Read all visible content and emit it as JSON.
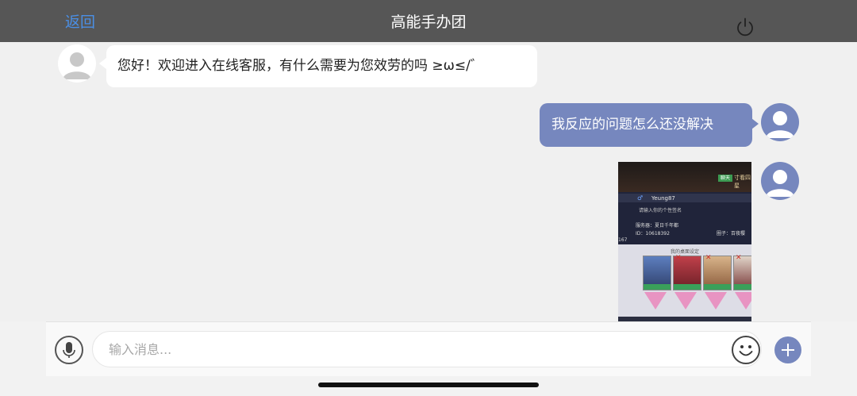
{
  "header": {
    "back_label": "返回",
    "title": "高能手办团",
    "power_icon": "power-icon"
  },
  "messages": [
    {
      "sender": "customer-service",
      "type": "text",
      "text": "您好！欢迎进入在线客服，有什么需要为您效劳的吗 ≥ω≤/゛"
    },
    {
      "sender": "user",
      "type": "text",
      "text": "我反应的问题怎么还没解决"
    },
    {
      "sender": "user",
      "type": "image",
      "screenshot_text": {
        "tag": "聊天",
        "tag_side": "寸看四星",
        "sex_symbol": "♂",
        "player_name": "Yeung87",
        "signature": "请输入你的个性签名",
        "server": "服务器：夏日千年都",
        "player_id": "ID：10618392",
        "circle": "圈子：百夜樱",
        "side_number": "167",
        "board_title": "我的桌面设定"
      }
    }
  ],
  "input": {
    "placeholder": "输入消息...",
    "value": "",
    "mic_icon": "microphone-icon",
    "emoji_icon": "emoji-icon",
    "plus_icon": "plus-icon"
  },
  "colors": {
    "header_bg": "#565656",
    "link": "#4a8fe6",
    "user_bubble": "#7687be",
    "cs_bubble": "#ffffff",
    "page_bg": "#f0f0f0"
  }
}
